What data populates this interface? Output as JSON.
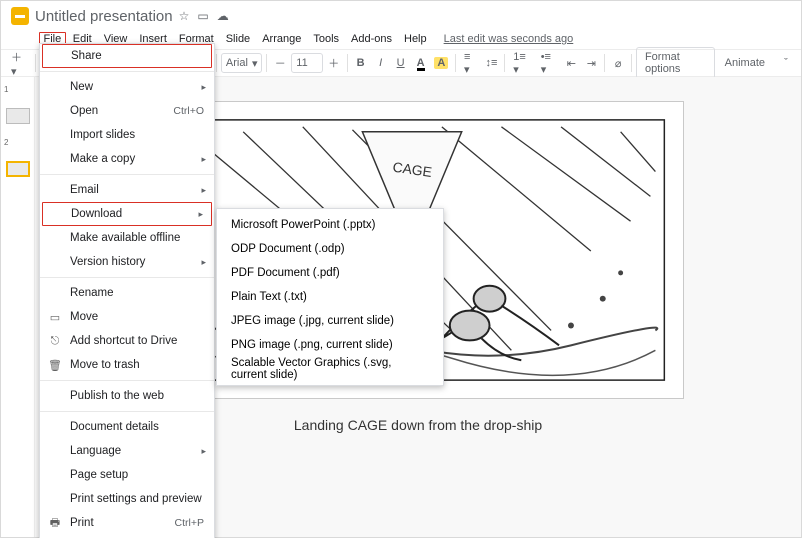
{
  "header": {
    "doc_title": "Untitled presentation"
  },
  "menubar": {
    "file": "File",
    "edit": "Edit",
    "view": "View",
    "insert": "Insert",
    "format": "Format",
    "slide": "Slide",
    "arrange": "Arrange",
    "tools": "Tools",
    "addons": "Add-ons",
    "help": "Help",
    "last_edit": "Last edit was seconds ago"
  },
  "toolbar": {
    "font": "Arial",
    "font_size": "11",
    "format_options": "Format options",
    "animate": "Animate",
    "bold": "B",
    "italic": "I",
    "underline": "U",
    "textcolor": "A",
    "highlight": "A"
  },
  "file_menu": {
    "share": "Share",
    "new": "New",
    "open": "Open",
    "open_kb": "Ctrl+O",
    "import_slides": "Import slides",
    "make_copy": "Make a copy",
    "email": "Email",
    "download": "Download",
    "offline": "Make available offline",
    "version": "Version history",
    "rename": "Rename",
    "move": "Move",
    "shortcut": "Add shortcut to Drive",
    "trash": "Move to trash",
    "publish": "Publish to the web",
    "details": "Document details",
    "language": "Language",
    "page_setup": "Page setup",
    "print_settings": "Print settings and preview",
    "print": "Print",
    "print_kb": "Ctrl+P"
  },
  "download_menu": {
    "pptx": "Microsoft PowerPoint (.pptx)",
    "odp": "ODP Document (.odp)",
    "pdf": "PDF Document (.pdf)",
    "txt": "Plain Text (.txt)",
    "jpg": "JPEG image (.jpg, current slide)",
    "png": "PNG image (.png, current slide)",
    "svg": "Scalable Vector Graphics (.svg, current slide)"
  },
  "slide": {
    "caption": "Landing CAGE down from the drop-ship",
    "callout": "CAGE"
  },
  "thumbs": {
    "n1": "1",
    "n2": "2"
  }
}
